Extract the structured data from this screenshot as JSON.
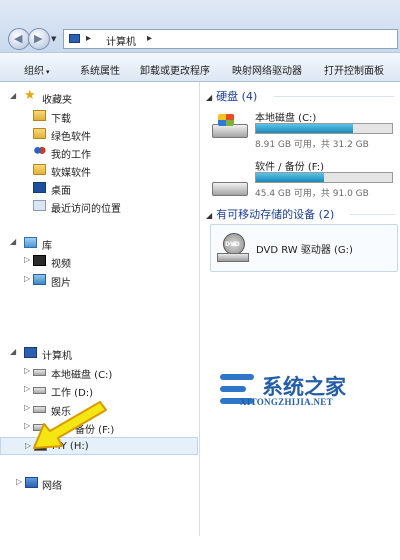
{
  "address": {
    "crumb_sep": "▸",
    "location": "计算机",
    "end_arrow": "▸"
  },
  "toolbar": {
    "organize": "组织",
    "organize_dd": "▾",
    "system_props": "系统属性",
    "uninstall": "卸载或更改程序",
    "map_drive": "映射网络驱动器",
    "control_panel": "打开控制面板"
  },
  "nav": {
    "favorites": {
      "label": "收藏夹",
      "items": [
        {
          "label": "下载",
          "icon": "download-folder-icon"
        },
        {
          "label": "绿色软件",
          "icon": "folder-icon"
        },
        {
          "label": "我的工作",
          "icon": "people-icon"
        },
        {
          "label": "软媒软件",
          "icon": "folder-icon"
        },
        {
          "label": "桌面",
          "icon": "desktop-icon"
        },
        {
          "label": "最近访问的位置",
          "icon": "recent-places-icon"
        }
      ]
    },
    "libraries": {
      "label": "库",
      "items": [
        {
          "label": "视频",
          "icon": "video-library-icon"
        },
        {
          "label": "图片",
          "icon": "picture-library-icon"
        }
      ]
    },
    "computer": {
      "label": "计算机",
      "items": [
        {
          "label": "本地磁盘 (C:)"
        },
        {
          "label": "工作 (D:)"
        },
        {
          "label": "娱乐 (E:)",
          "partial": "娱乐"
        },
        {
          "label": "备份 (F:)",
          "partial": "备份 (F:)"
        },
        {
          "label": "MY (H:)"
        }
      ]
    },
    "network": {
      "label": "网络"
    }
  },
  "content": {
    "hdd_group": {
      "title": "硬盘 (4)"
    },
    "drives": [
      {
        "name": "本地磁盘 (C:)",
        "info": "8.91 GB 可用，共 31.2 GB",
        "used_fraction": 0.71
      },
      {
        "name": "软件 / 备份 (F:)",
        "info": "45.4 GB 可用，共 91.0 GB",
        "used_fraction": 0.5
      }
    ],
    "removable_group": {
      "title": "有可移动存储的设备 (2)"
    },
    "dvd": {
      "name": "DVD RW 驱动器 (G:)",
      "badge": "DVD"
    }
  },
  "watermark": {
    "title": "系统之家",
    "url": "XITONGZHIJIA.NET"
  },
  "colors": {
    "accent": "#1e3f93",
    "arrow_fill": "#f5e511",
    "arrow_stroke": "#d89a00",
    "bar_fill": "#1a89b8",
    "watermark": "#245ea8"
  }
}
